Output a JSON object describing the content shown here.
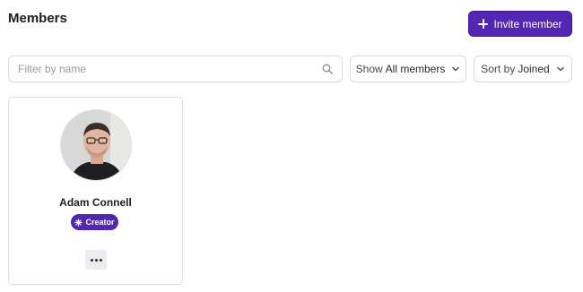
{
  "header": {
    "title": "Members",
    "invite_label": "Invite member"
  },
  "filters": {
    "search_placeholder": "Filter by name",
    "show_prefix": "Show",
    "show_value": "All members",
    "sort_prefix": "Sort by",
    "sort_value": "Joined"
  },
  "members": [
    {
      "name": "Adam Connell",
      "role": "Creator"
    }
  ],
  "colors": {
    "accent": "#5127b4",
    "border": "#d9d9de"
  },
  "icons": {
    "invite": "plus-icon",
    "search": "search-icon",
    "dropdown": "chevron-down-icon",
    "role": "sparkle-icon",
    "more": "more-dots-icon"
  }
}
